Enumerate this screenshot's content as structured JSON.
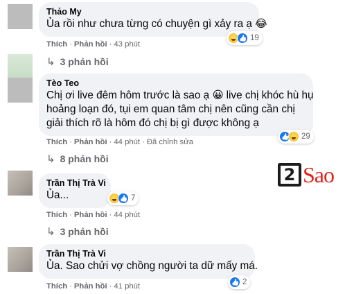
{
  "comments": [
    {
      "author": "Thảo My",
      "text": "Ủa rồi như chưa từng có chuyện gì xảy ra ạ 😂",
      "reactions": [
        "haha",
        "like"
      ],
      "reaction_count": "19",
      "actions": {
        "like": "Thích",
        "reply": "Phản hồi",
        "time": "43 phút"
      },
      "replies": "3 phản hồi"
    },
    {
      "author": "Tèo Teo",
      "text_lines": [
        "Chị ơi live đêm hôm trước là sao ạ 😀 live chị khóc hù hụ",
        "hoảng loạn đó, tụi em quan tâm chị nên cũng cần chị",
        "giải thích rõ là hôm đó chị bị gì được không ạ"
      ],
      "reactions": [
        "like",
        "haha"
      ],
      "reaction_count": "29",
      "actions": {
        "like": "Thích",
        "reply": "Phản hồi",
        "time": "44 phút",
        "edited": "Đã chỉnh sửa"
      },
      "replies": "8 phản hồi"
    },
    {
      "author": "Trần Thị Trà Vi",
      "text": "Ủa...",
      "reactions": [
        "haha",
        "like"
      ],
      "reaction_count": "7",
      "actions": {
        "like": "Thích",
        "reply": "Phản hồi",
        "time": "44 phút"
      },
      "replies": "3 phản hồi"
    },
    {
      "author": "Trần Thị Trà Vi",
      "text": "Ủa. Sao chửi vợ chồng người ta dữ mấy má.",
      "reactions": [
        "like"
      ],
      "reaction_count": "2",
      "actions": {
        "like": "Thích",
        "reply": "Phản hồi",
        "time": "41 phút"
      }
    }
  ],
  "separator": "·",
  "reply_arrow": "↳",
  "watermark": {
    "number": "2",
    "word": "Sao"
  },
  "colors": {
    "bubble": "#f0f2f5",
    "meta": "#65676b",
    "like_blue": "#1877f2",
    "watermark_red": "#e2231a"
  }
}
